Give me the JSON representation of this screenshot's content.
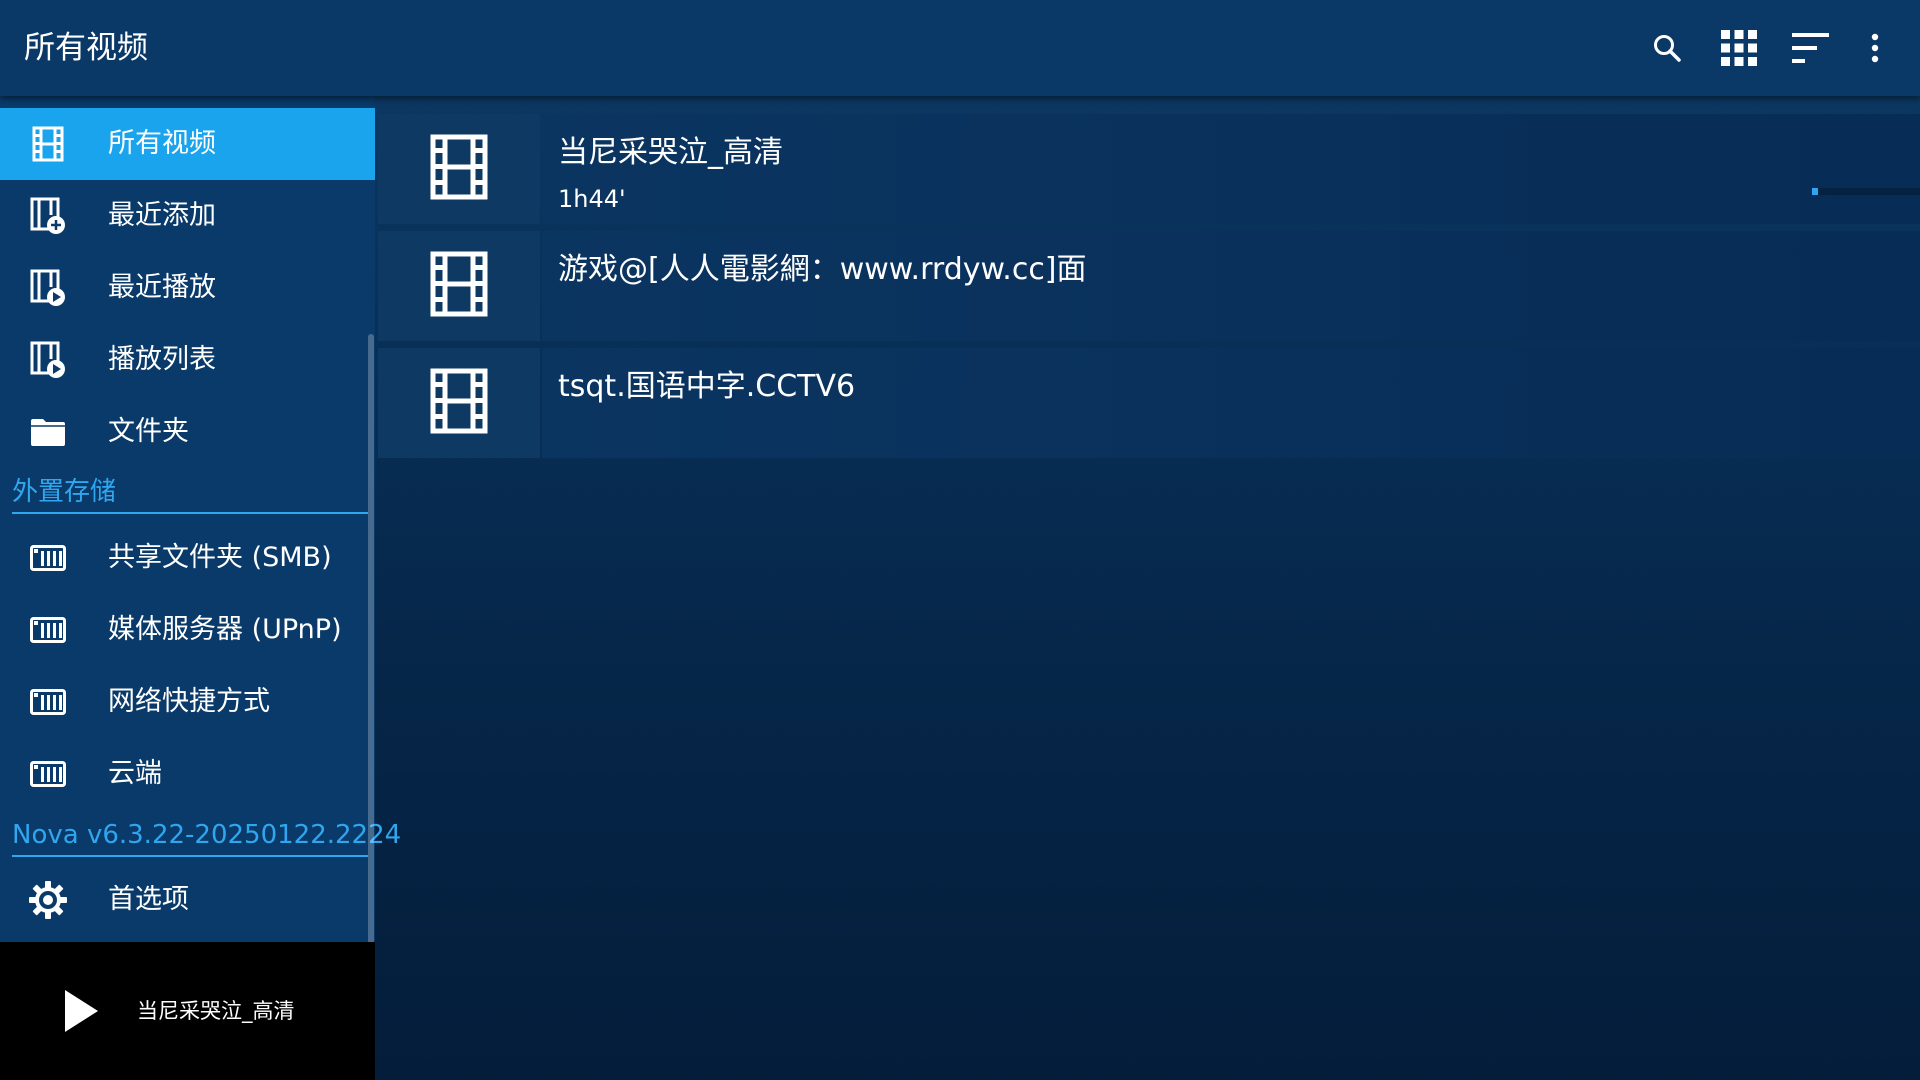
{
  "app": {
    "title": "所有视频"
  },
  "toolbar": {
    "icons": [
      "search-icon",
      "grid-view-icon",
      "sort-icon",
      "more-vert-icon"
    ]
  },
  "sidebar": {
    "items": [
      {
        "label": "所有视频",
        "icon": "movie-icon",
        "active": true
      },
      {
        "label": "最近添加",
        "icon": "movie-add-icon"
      },
      {
        "label": "最近播放",
        "icon": "movie-play-icon"
      },
      {
        "label": "播放列表",
        "icon": "playlist-icon"
      },
      {
        "label": "文件夹",
        "icon": "folder-icon"
      }
    ],
    "section_external": "外置存储",
    "external_items": [
      {
        "label": "共享文件夹 (SMB)",
        "icon": "network-drive-icon"
      },
      {
        "label": "媒体服务器 (UPnP)",
        "icon": "network-drive-icon"
      },
      {
        "label": "网络快捷方式",
        "icon": "network-drive-icon"
      },
      {
        "label": "云端",
        "icon": "network-drive-icon"
      }
    ],
    "version": "Nova v6.3.22-20250122.2224",
    "preferences": {
      "label": "首选项",
      "icon": "gear-icon"
    }
  },
  "now_playing": {
    "title": "当尼采哭泣_高清",
    "icon": "play-icon"
  },
  "videos": [
    {
      "name": "当尼采哭泣_高清",
      "duration": "1h44'",
      "progress": 0.04
    },
    {
      "name": "游戏@[人人電影網：www.rrdyw.cc]面",
      "duration": ""
    },
    {
      "name": "tsqt.国语中字.CCTV6",
      "duration": ""
    }
  ],
  "colors": {
    "accent": "#1aa4ee",
    "section_text": "#2fa6ee",
    "topbar": "#0a3867",
    "sidebar": "#093a6a",
    "background": "#06284c"
  }
}
